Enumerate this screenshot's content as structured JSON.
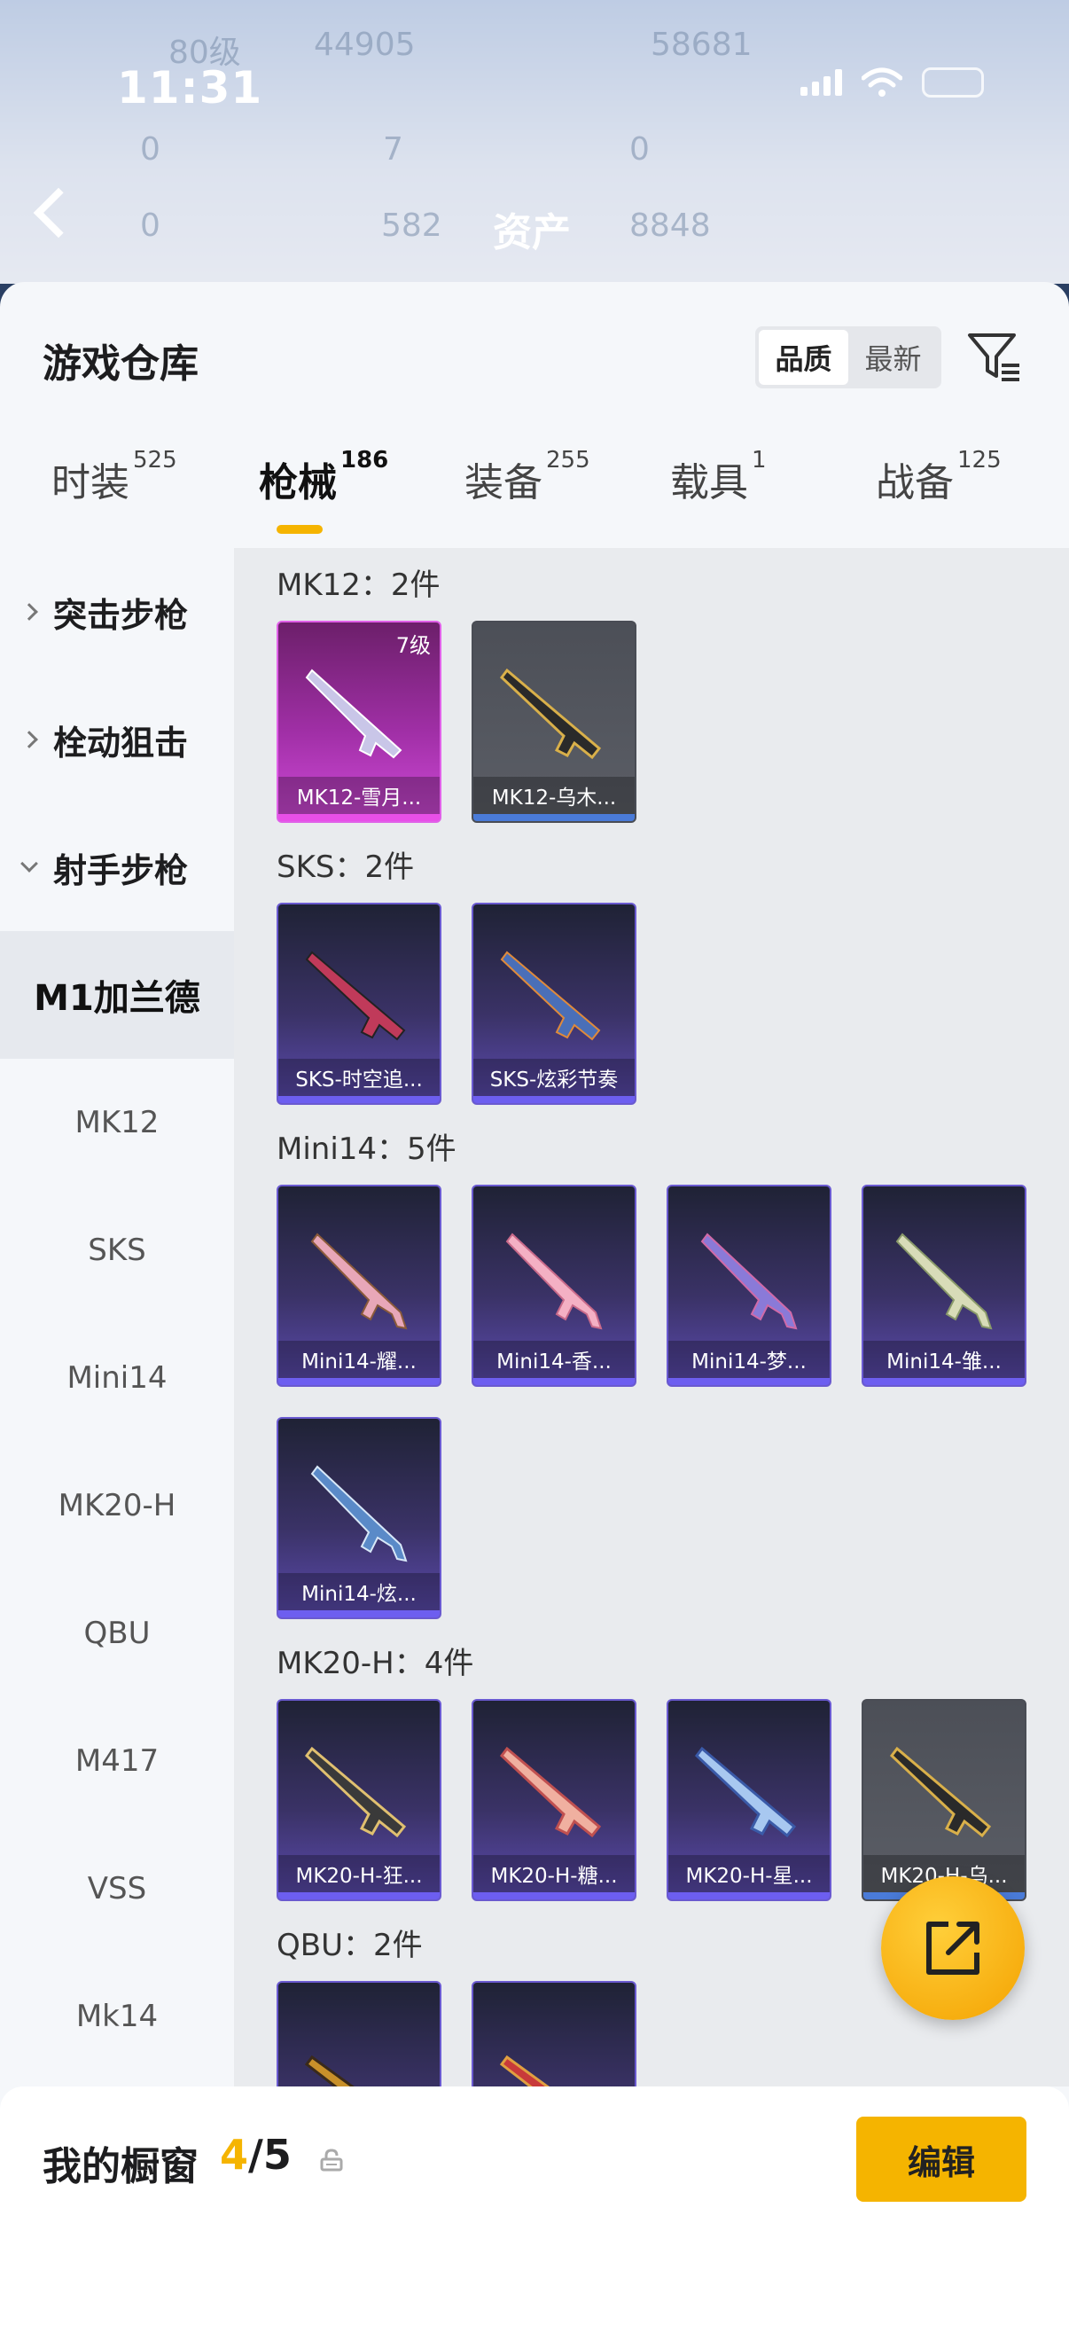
{
  "status": {
    "time": "11:31"
  },
  "background": {
    "level_text": "80级",
    "score1": "44905",
    "score2": "58681",
    "stat_a": "0",
    "stat_b": "7",
    "stat_c": "0",
    "stat_d": "0",
    "stat_e": "582",
    "stat_f": "8848",
    "title": "资产"
  },
  "sheet": {
    "title": "游戏仓库",
    "sort_quality": "品质",
    "sort_newest": "最新"
  },
  "tabs": [
    {
      "label": "时装",
      "count": "525"
    },
    {
      "label": "枪械",
      "count": "186"
    },
    {
      "label": "装备",
      "count": "255"
    },
    {
      "label": "载具",
      "count": "1"
    },
    {
      "label": "战备",
      "count": "125"
    }
  ],
  "sidebar": {
    "categories": [
      "突击步枪",
      "栓动狙击",
      "射手步枪"
    ],
    "items": [
      "M1加兰德",
      "MK12",
      "SKS",
      "Mini14",
      "MK20-H",
      "QBU",
      "M417",
      "VSS",
      "Mk14"
    ]
  },
  "groups": [
    {
      "title": "MK12：2件",
      "cards": [
        {
          "name": "MK12-雪月...",
          "level": "7级",
          "style": "pink"
        },
        {
          "name": "MK12-乌木...",
          "style": "gray"
        }
      ]
    },
    {
      "title": "SKS：2件",
      "cards": [
        {
          "name": "SKS-时空追...",
          "style": "purple"
        },
        {
          "name": "SKS-炫彩节奏",
          "style": "purple"
        }
      ]
    },
    {
      "title": "Mini14：5件",
      "cards": [
        {
          "name": "Mini14-耀...",
          "style": "purple"
        },
        {
          "name": "Mini14-香...",
          "style": "purple"
        },
        {
          "name": "Mini14-梦...",
          "style": "purple"
        },
        {
          "name": "Mini14-雏...",
          "style": "purple"
        },
        {
          "name": "Mini14-炫...",
          "style": "purple"
        }
      ]
    },
    {
      "title": "MK20-H：4件",
      "cards": [
        {
          "name": "MK20-H-狂...",
          "style": "purple"
        },
        {
          "name": "MK20-H-糖...",
          "style": "purple"
        },
        {
          "name": "MK20-H-星...",
          "style": "purple"
        },
        {
          "name": "MK20-H-乌...",
          "style": "gray"
        }
      ]
    },
    {
      "title": "QBU：2件",
      "cards": []
    }
  ],
  "bottom": {
    "title": "我的橱窗",
    "count_current": "4",
    "count_total": "/5",
    "edit_label": "编辑"
  },
  "colors": {
    "accent": "#f5b400",
    "purple": "#6d5ef0",
    "pink": "#e84fe8"
  }
}
